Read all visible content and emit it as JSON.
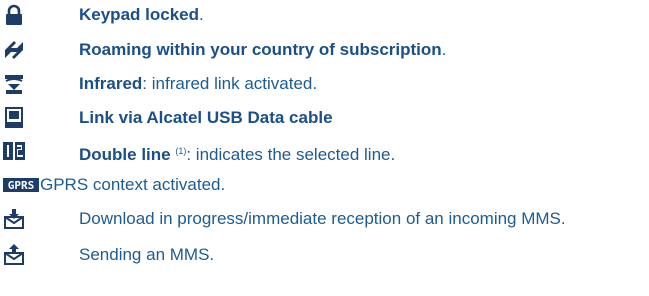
{
  "colors": {
    "text": "#1b5c95",
    "bold": "#1a4f8a",
    "icon": "#1d3c68"
  },
  "rows": [
    {
      "icon": "padlock-icon",
      "bold": "Keypad locked",
      "rest": "."
    },
    {
      "icon": "roaming-icon",
      "bold": "Roaming within your country of subscription",
      "rest": "."
    },
    {
      "icon": "infrared-icon",
      "bold": "Infrared",
      "rest": ": infrared link activated."
    },
    {
      "icon": "usb-cable-icon",
      "bold": "Link via Alcatel USB Data cable",
      "rest": ""
    },
    {
      "icon": "double-line-icon",
      "bold": "Double line",
      "sup": "(1)",
      "rest": ": indicates the selected line."
    },
    {
      "icon": "gprs-icon",
      "label": "GPRS",
      "rest": "GPRS context activated."
    },
    {
      "icon": "mms-download-icon",
      "rest": "Download in progress/immediate reception of an incoming MMS."
    },
    {
      "icon": "mms-send-icon",
      "rest": "Sending an MMS."
    }
  ]
}
